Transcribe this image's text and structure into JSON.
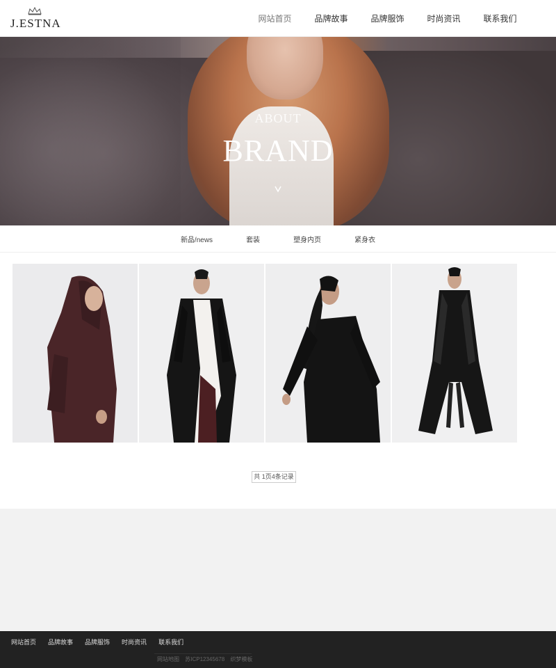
{
  "header": {
    "logo_text": "J.ESTNA",
    "nav": [
      {
        "label": "网站首页",
        "active": true
      },
      {
        "label": "品牌故事",
        "active": false
      },
      {
        "label": "品牌服饰",
        "active": false
      },
      {
        "label": "时尚资讯",
        "active": false
      },
      {
        "label": "联系我们",
        "active": false
      }
    ]
  },
  "banner": {
    "eyebrow": "ABOUT",
    "title": "BRAND"
  },
  "subnav": [
    "新品/news",
    "套装",
    "塑身内页",
    "紧身衣"
  ],
  "gallery": [
    {
      "alt": "burgundy hooded outfit"
    },
    {
      "alt": "black and white long coat"
    },
    {
      "alt": "black blazer outfit"
    },
    {
      "alt": "long black velvet coat"
    }
  ],
  "pagination": {
    "text": "共 1页4条记录"
  },
  "footer": {
    "nav": [
      "网站首页",
      "品牌故事",
      "品牌服饰",
      "时尚资讯",
      "联系我们"
    ],
    "meta": [
      "网站地图",
      "苏ICP12345678",
      "织梦模板"
    ]
  }
}
